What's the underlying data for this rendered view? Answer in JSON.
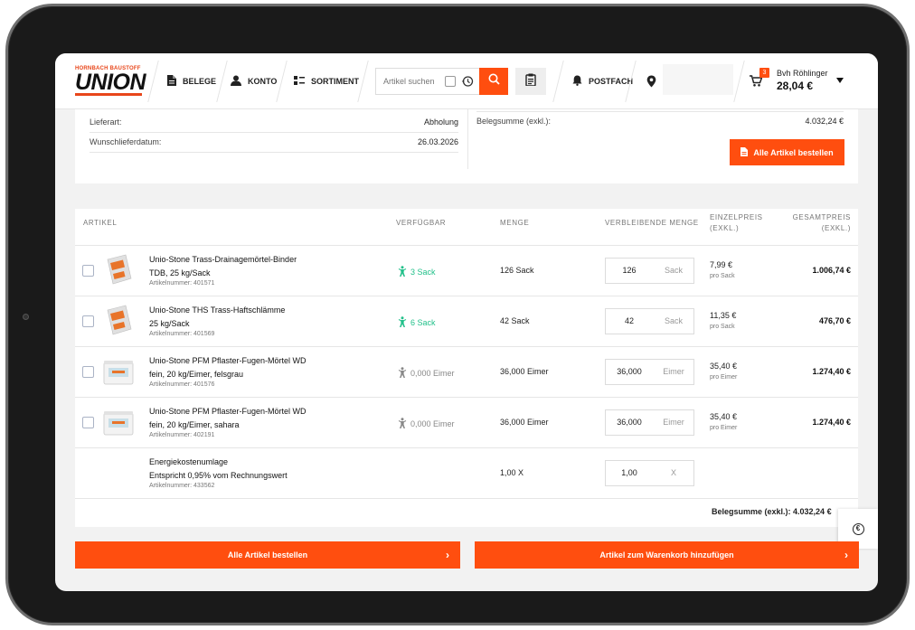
{
  "header": {
    "logo": {
      "top_text": "HORNBACH BAUSTOFF",
      "main_text": "UNION"
    },
    "nav": [
      {
        "label": "BELEGE"
      },
      {
        "label": "KONTO"
      },
      {
        "label": "SORTIMENT"
      }
    ],
    "search": {
      "placeholder": "Artikel suchen"
    },
    "postfach_label": "POSTFACH",
    "cart": {
      "badge": "3",
      "user": "Bvh Röhlinger",
      "amount": "28,04 €"
    }
  },
  "summary": {
    "left": [
      {
        "label": "Lieferart:",
        "value": "Abholung"
      },
      {
        "label": "Wunschlieferdatum:",
        "value": "26.03.2026"
      }
    ],
    "right": [
      {
        "label": "Belegsumme (exkl.):",
        "value": "4.032,24 €"
      }
    ],
    "order_all_label": "Alle Artikel bestellen"
  },
  "table": {
    "headers": {
      "artikel": "ARTIKEL",
      "verfuegbar": "VERFÜGBAR",
      "menge": "MENGE",
      "verbleibende": "VERBLEIBENDE MENGE",
      "einzelpreis": "EINZELPREIS\n(EXKL.)",
      "gesamtpreis": "GESAMTPREIS\n(EXKL.)"
    },
    "rows": [
      {
        "name_line1": "Unio-Stone Trass-Drainagemörtel-Binder",
        "name_line2": "TDB, 25 kg/Sack",
        "artno": "Artikelnummer: 401571",
        "available": "3 Sack",
        "available_status": "green",
        "quantity": "126 Sack",
        "remaining_value": "126",
        "remaining_unit": "Sack",
        "unit_price": "7,99 €",
        "unit_price_sub": "pro Sack",
        "total": "1.006,74 €",
        "thumb": "bag"
      },
      {
        "name_line1": "Unio-Stone THS Trass-Haftschlämme",
        "name_line2": "25 kg/Sack",
        "artno": "Artikelnummer: 401569",
        "available": "6 Sack",
        "available_status": "green",
        "quantity": "42 Sack",
        "remaining_value": "42",
        "remaining_unit": "Sack",
        "unit_price": "11,35 €",
        "unit_price_sub": "pro Sack",
        "total": "476,70 €",
        "thumb": "bag"
      },
      {
        "name_line1": "Unio-Stone PFM Pflaster-Fugen-Mörtel WD",
        "name_line2": "fein, 20 kg/Eimer, felsgrau",
        "artno": "Artikelnummer: 401576",
        "available": "0,000 Eimer",
        "available_status": "grey",
        "quantity": "36,000 Eimer",
        "remaining_value": "36,000",
        "remaining_unit": "Eimer",
        "unit_price": "35,40 €",
        "unit_price_sub": "pro Eimer",
        "total": "1.274,40 €",
        "thumb": "bucket"
      },
      {
        "name_line1": "Unio-Stone PFM Pflaster-Fugen-Mörtel WD",
        "name_line2": "fein, 20 kg/Eimer, sahara",
        "artno": "Artikelnummer: 402191",
        "available": "0,000 Eimer",
        "available_status": "grey",
        "quantity": "36,000 Eimer",
        "remaining_value": "36,000",
        "remaining_unit": "Eimer",
        "unit_price": "35,40 €",
        "unit_price_sub": "pro Eimer",
        "total": "1.274,40 €",
        "thumb": "bucket"
      },
      {
        "name_line1": "Energiekostenumlage",
        "name_line2": "Entspricht 0,95% vom Rechnungswert",
        "artno": "Artikelnummer: 433562",
        "available": "",
        "available_status": "none",
        "quantity": "1,00 X",
        "remaining_value": "1,00",
        "remaining_unit": "X",
        "unit_price": "",
        "unit_price_sub": "",
        "total": "",
        "thumb": "none"
      }
    ],
    "belegsumme": "Belegsumme (exkl.): 4.032,24 €"
  },
  "footer": {
    "order_all_label": "Alle Artikel bestellen",
    "add_to_cart_label": "Artikel zum Warenkorb hinzufügen"
  },
  "colors": {
    "accent": "#ff4e0f",
    "available_green": "#22c08a"
  }
}
